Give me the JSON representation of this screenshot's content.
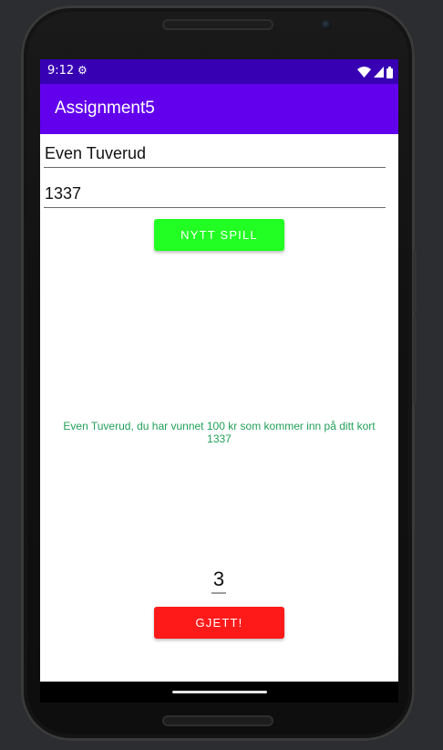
{
  "status_bar": {
    "time": "9:12",
    "gear_icon": "settings-notification-icon",
    "wifi_icon": "wifi-icon",
    "signal_icon": "signal-icon",
    "battery_icon": "battery-icon"
  },
  "app_bar": {
    "title": "Assignment5"
  },
  "form": {
    "name_value": "Even Tuverud",
    "number_value": "1337"
  },
  "buttons": {
    "new_game_label": "NYTT SPILL",
    "guess_label": "GJETT!"
  },
  "message": {
    "line1": "Even Tuverud, du har vunnet 100 kr som kommer inn på ditt kort",
    "line2": "1337"
  },
  "guess": {
    "value": "3"
  },
  "colors": {
    "status_bar": "#3700b3",
    "app_bar": "#6200ee",
    "new_game_button": "#22ff22",
    "guess_button": "#ff1a1a",
    "message_text": "#22a05a"
  }
}
